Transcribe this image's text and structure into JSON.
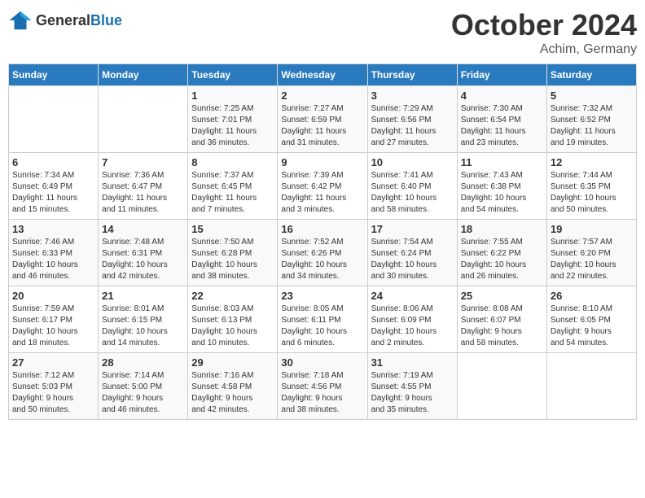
{
  "header": {
    "logo_general": "General",
    "logo_blue": "Blue",
    "month": "October 2024",
    "location": "Achim, Germany"
  },
  "weekdays": [
    "Sunday",
    "Monday",
    "Tuesday",
    "Wednesday",
    "Thursday",
    "Friday",
    "Saturday"
  ],
  "weeks": [
    [
      {
        "day": "",
        "info": ""
      },
      {
        "day": "",
        "info": ""
      },
      {
        "day": "1",
        "info": "Sunrise: 7:25 AM\nSunset: 7:01 PM\nDaylight: 11 hours\nand 36 minutes."
      },
      {
        "day": "2",
        "info": "Sunrise: 7:27 AM\nSunset: 6:59 PM\nDaylight: 11 hours\nand 31 minutes."
      },
      {
        "day": "3",
        "info": "Sunrise: 7:29 AM\nSunset: 6:56 PM\nDaylight: 11 hours\nand 27 minutes."
      },
      {
        "day": "4",
        "info": "Sunrise: 7:30 AM\nSunset: 6:54 PM\nDaylight: 11 hours\nand 23 minutes."
      },
      {
        "day": "5",
        "info": "Sunrise: 7:32 AM\nSunset: 6:52 PM\nDaylight: 11 hours\nand 19 minutes."
      }
    ],
    [
      {
        "day": "6",
        "info": "Sunrise: 7:34 AM\nSunset: 6:49 PM\nDaylight: 11 hours\nand 15 minutes."
      },
      {
        "day": "7",
        "info": "Sunrise: 7:36 AM\nSunset: 6:47 PM\nDaylight: 11 hours\nand 11 minutes."
      },
      {
        "day": "8",
        "info": "Sunrise: 7:37 AM\nSunset: 6:45 PM\nDaylight: 11 hours\nand 7 minutes."
      },
      {
        "day": "9",
        "info": "Sunrise: 7:39 AM\nSunset: 6:42 PM\nDaylight: 11 hours\nand 3 minutes."
      },
      {
        "day": "10",
        "info": "Sunrise: 7:41 AM\nSunset: 6:40 PM\nDaylight: 10 hours\nand 58 minutes."
      },
      {
        "day": "11",
        "info": "Sunrise: 7:43 AM\nSunset: 6:38 PM\nDaylight: 10 hours\nand 54 minutes."
      },
      {
        "day": "12",
        "info": "Sunrise: 7:44 AM\nSunset: 6:35 PM\nDaylight: 10 hours\nand 50 minutes."
      }
    ],
    [
      {
        "day": "13",
        "info": "Sunrise: 7:46 AM\nSunset: 6:33 PM\nDaylight: 10 hours\nand 46 minutes."
      },
      {
        "day": "14",
        "info": "Sunrise: 7:48 AM\nSunset: 6:31 PM\nDaylight: 10 hours\nand 42 minutes."
      },
      {
        "day": "15",
        "info": "Sunrise: 7:50 AM\nSunset: 6:28 PM\nDaylight: 10 hours\nand 38 minutes."
      },
      {
        "day": "16",
        "info": "Sunrise: 7:52 AM\nSunset: 6:26 PM\nDaylight: 10 hours\nand 34 minutes."
      },
      {
        "day": "17",
        "info": "Sunrise: 7:54 AM\nSunset: 6:24 PM\nDaylight: 10 hours\nand 30 minutes."
      },
      {
        "day": "18",
        "info": "Sunrise: 7:55 AM\nSunset: 6:22 PM\nDaylight: 10 hours\nand 26 minutes."
      },
      {
        "day": "19",
        "info": "Sunrise: 7:57 AM\nSunset: 6:20 PM\nDaylight: 10 hours\nand 22 minutes."
      }
    ],
    [
      {
        "day": "20",
        "info": "Sunrise: 7:59 AM\nSunset: 6:17 PM\nDaylight: 10 hours\nand 18 minutes."
      },
      {
        "day": "21",
        "info": "Sunrise: 8:01 AM\nSunset: 6:15 PM\nDaylight: 10 hours\nand 14 minutes."
      },
      {
        "day": "22",
        "info": "Sunrise: 8:03 AM\nSunset: 6:13 PM\nDaylight: 10 hours\nand 10 minutes."
      },
      {
        "day": "23",
        "info": "Sunrise: 8:05 AM\nSunset: 6:11 PM\nDaylight: 10 hours\nand 6 minutes."
      },
      {
        "day": "24",
        "info": "Sunrise: 8:06 AM\nSunset: 6:09 PM\nDaylight: 10 hours\nand 2 minutes."
      },
      {
        "day": "25",
        "info": "Sunrise: 8:08 AM\nSunset: 6:07 PM\nDaylight: 9 hours\nand 58 minutes."
      },
      {
        "day": "26",
        "info": "Sunrise: 8:10 AM\nSunset: 6:05 PM\nDaylight: 9 hours\nand 54 minutes."
      }
    ],
    [
      {
        "day": "27",
        "info": "Sunrise: 7:12 AM\nSunset: 5:03 PM\nDaylight: 9 hours\nand 50 minutes."
      },
      {
        "day": "28",
        "info": "Sunrise: 7:14 AM\nSunset: 5:00 PM\nDaylight: 9 hours\nand 46 minutes."
      },
      {
        "day": "29",
        "info": "Sunrise: 7:16 AM\nSunset: 4:58 PM\nDaylight: 9 hours\nand 42 minutes."
      },
      {
        "day": "30",
        "info": "Sunrise: 7:18 AM\nSunset: 4:56 PM\nDaylight: 9 hours\nand 38 minutes."
      },
      {
        "day": "31",
        "info": "Sunrise: 7:19 AM\nSunset: 4:55 PM\nDaylight: 9 hours\nand 35 minutes."
      },
      {
        "day": "",
        "info": ""
      },
      {
        "day": "",
        "info": ""
      }
    ]
  ]
}
